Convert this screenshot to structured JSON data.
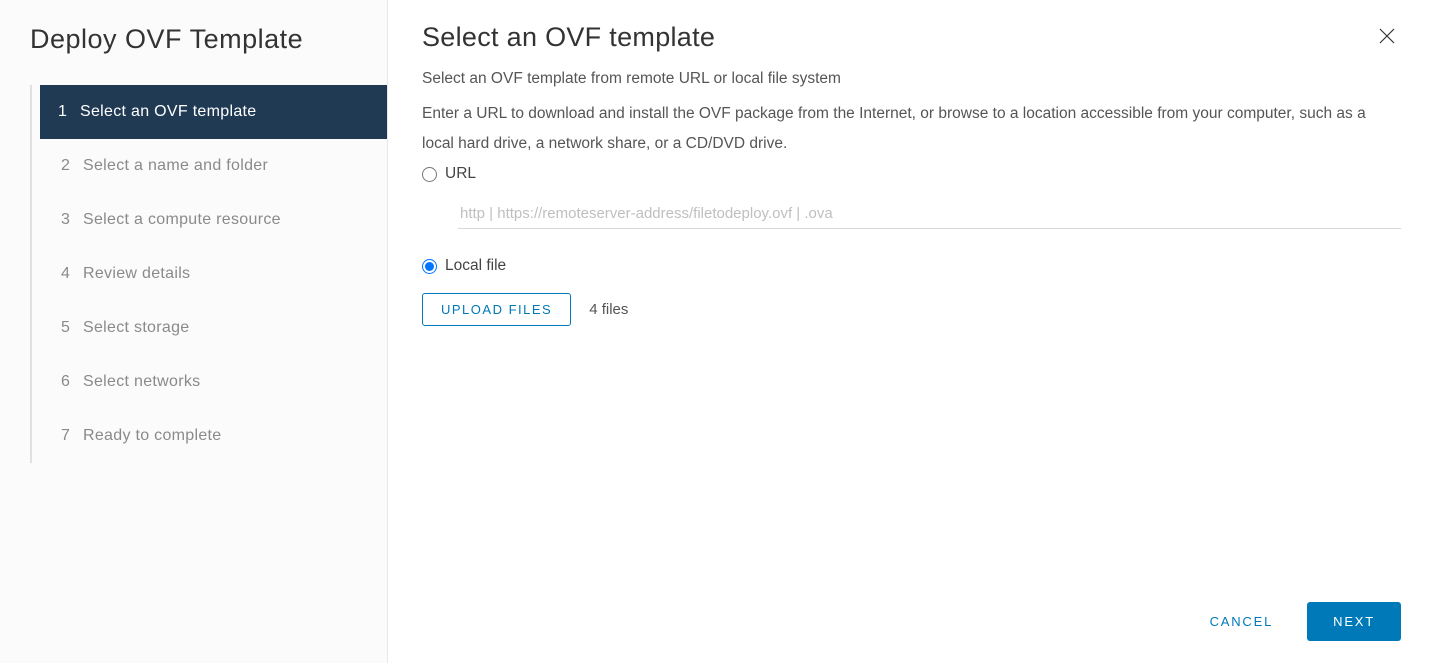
{
  "sidebar": {
    "title": "Deploy OVF Template",
    "steps": [
      {
        "num": "1",
        "label": "Select an OVF template",
        "active": true
      },
      {
        "num": "2",
        "label": "Select a name and folder",
        "active": false
      },
      {
        "num": "3",
        "label": "Select a compute resource",
        "active": false
      },
      {
        "num": "4",
        "label": "Review details",
        "active": false
      },
      {
        "num": "5",
        "label": "Select storage",
        "active": false
      },
      {
        "num": "6",
        "label": "Select networks",
        "active": false
      },
      {
        "num": "7",
        "label": "Ready to complete",
        "active": false
      }
    ]
  },
  "main": {
    "title": "Select an OVF template",
    "subtitle": "Select an OVF template from remote URL or local file system",
    "description": "Enter a URL to download and install the OVF package from the Internet, or browse to a location accessible from your computer, such as a local hard drive, a network share, or a CD/DVD drive.",
    "options": {
      "url_label": "URL",
      "url_placeholder": "http | https://remoteserver-address/filetodeploy.ovf | .ova",
      "local_file_label": "Local file",
      "selected": "local"
    },
    "upload_button": "UPLOAD FILES",
    "files_count": "4 files"
  },
  "footer": {
    "cancel": "CANCEL",
    "next": "NEXT"
  }
}
